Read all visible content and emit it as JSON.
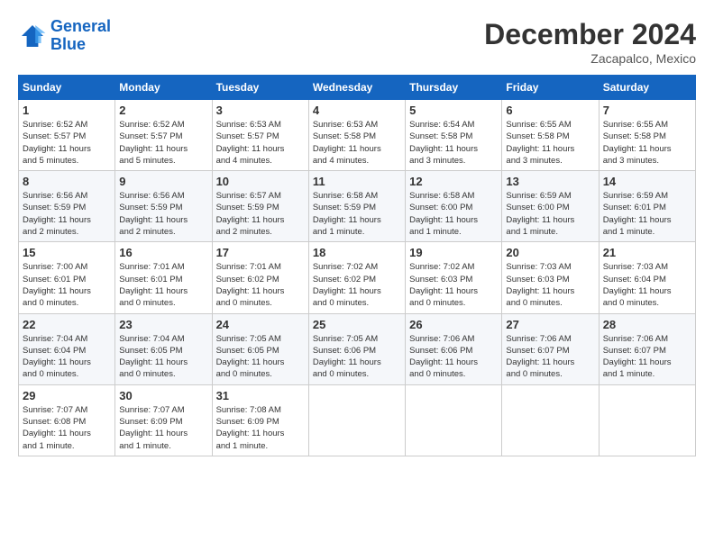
{
  "header": {
    "logo_line1": "General",
    "logo_line2": "Blue",
    "month_title": "December 2024",
    "location": "Zacapalco, Mexico"
  },
  "days_of_week": [
    "Sunday",
    "Monday",
    "Tuesday",
    "Wednesday",
    "Thursday",
    "Friday",
    "Saturday"
  ],
  "weeks": [
    [
      {
        "day": "1",
        "info": "Sunrise: 6:52 AM\nSunset: 5:57 PM\nDaylight: 11 hours\nand 5 minutes."
      },
      {
        "day": "2",
        "info": "Sunrise: 6:52 AM\nSunset: 5:57 PM\nDaylight: 11 hours\nand 5 minutes."
      },
      {
        "day": "3",
        "info": "Sunrise: 6:53 AM\nSunset: 5:57 PM\nDaylight: 11 hours\nand 4 minutes."
      },
      {
        "day": "4",
        "info": "Sunrise: 6:53 AM\nSunset: 5:58 PM\nDaylight: 11 hours\nand 4 minutes."
      },
      {
        "day": "5",
        "info": "Sunrise: 6:54 AM\nSunset: 5:58 PM\nDaylight: 11 hours\nand 3 minutes."
      },
      {
        "day": "6",
        "info": "Sunrise: 6:55 AM\nSunset: 5:58 PM\nDaylight: 11 hours\nand 3 minutes."
      },
      {
        "day": "7",
        "info": "Sunrise: 6:55 AM\nSunset: 5:58 PM\nDaylight: 11 hours\nand 3 minutes."
      }
    ],
    [
      {
        "day": "8",
        "info": "Sunrise: 6:56 AM\nSunset: 5:59 PM\nDaylight: 11 hours\nand 2 minutes."
      },
      {
        "day": "9",
        "info": "Sunrise: 6:56 AM\nSunset: 5:59 PM\nDaylight: 11 hours\nand 2 minutes."
      },
      {
        "day": "10",
        "info": "Sunrise: 6:57 AM\nSunset: 5:59 PM\nDaylight: 11 hours\nand 2 minutes."
      },
      {
        "day": "11",
        "info": "Sunrise: 6:58 AM\nSunset: 5:59 PM\nDaylight: 11 hours\nand 1 minute."
      },
      {
        "day": "12",
        "info": "Sunrise: 6:58 AM\nSunset: 6:00 PM\nDaylight: 11 hours\nand 1 minute."
      },
      {
        "day": "13",
        "info": "Sunrise: 6:59 AM\nSunset: 6:00 PM\nDaylight: 11 hours\nand 1 minute."
      },
      {
        "day": "14",
        "info": "Sunrise: 6:59 AM\nSunset: 6:01 PM\nDaylight: 11 hours\nand 1 minute."
      }
    ],
    [
      {
        "day": "15",
        "info": "Sunrise: 7:00 AM\nSunset: 6:01 PM\nDaylight: 11 hours\nand 0 minutes."
      },
      {
        "day": "16",
        "info": "Sunrise: 7:01 AM\nSunset: 6:01 PM\nDaylight: 11 hours\nand 0 minutes."
      },
      {
        "day": "17",
        "info": "Sunrise: 7:01 AM\nSunset: 6:02 PM\nDaylight: 11 hours\nand 0 minutes."
      },
      {
        "day": "18",
        "info": "Sunrise: 7:02 AM\nSunset: 6:02 PM\nDaylight: 11 hours\nand 0 minutes."
      },
      {
        "day": "19",
        "info": "Sunrise: 7:02 AM\nSunset: 6:03 PM\nDaylight: 11 hours\nand 0 minutes."
      },
      {
        "day": "20",
        "info": "Sunrise: 7:03 AM\nSunset: 6:03 PM\nDaylight: 11 hours\nand 0 minutes."
      },
      {
        "day": "21",
        "info": "Sunrise: 7:03 AM\nSunset: 6:04 PM\nDaylight: 11 hours\nand 0 minutes."
      }
    ],
    [
      {
        "day": "22",
        "info": "Sunrise: 7:04 AM\nSunset: 6:04 PM\nDaylight: 11 hours\nand 0 minutes."
      },
      {
        "day": "23",
        "info": "Sunrise: 7:04 AM\nSunset: 6:05 PM\nDaylight: 11 hours\nand 0 minutes."
      },
      {
        "day": "24",
        "info": "Sunrise: 7:05 AM\nSunset: 6:05 PM\nDaylight: 11 hours\nand 0 minutes."
      },
      {
        "day": "25",
        "info": "Sunrise: 7:05 AM\nSunset: 6:06 PM\nDaylight: 11 hours\nand 0 minutes."
      },
      {
        "day": "26",
        "info": "Sunrise: 7:06 AM\nSunset: 6:06 PM\nDaylight: 11 hours\nand 0 minutes."
      },
      {
        "day": "27",
        "info": "Sunrise: 7:06 AM\nSunset: 6:07 PM\nDaylight: 11 hours\nand 0 minutes."
      },
      {
        "day": "28",
        "info": "Sunrise: 7:06 AM\nSunset: 6:07 PM\nDaylight: 11 hours\nand 1 minute."
      }
    ],
    [
      {
        "day": "29",
        "info": "Sunrise: 7:07 AM\nSunset: 6:08 PM\nDaylight: 11 hours\nand 1 minute."
      },
      {
        "day": "30",
        "info": "Sunrise: 7:07 AM\nSunset: 6:09 PM\nDaylight: 11 hours\nand 1 minute."
      },
      {
        "day": "31",
        "info": "Sunrise: 7:08 AM\nSunset: 6:09 PM\nDaylight: 11 hours\nand 1 minute."
      },
      {
        "day": "",
        "info": ""
      },
      {
        "day": "",
        "info": ""
      },
      {
        "day": "",
        "info": ""
      },
      {
        "day": "",
        "info": ""
      }
    ]
  ]
}
